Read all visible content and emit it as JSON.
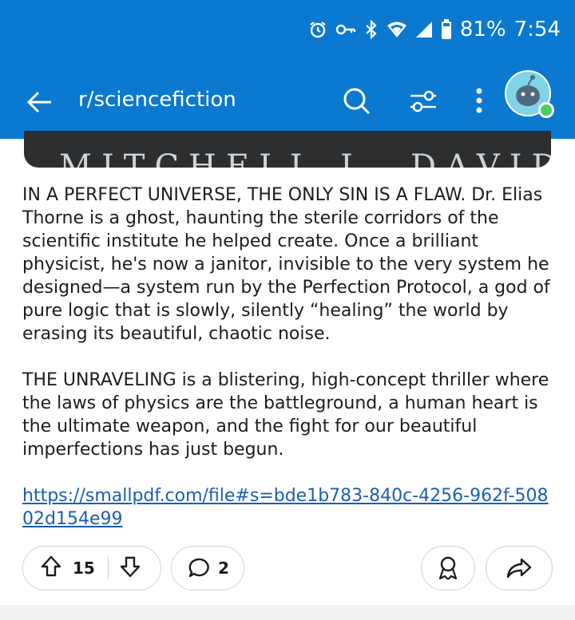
{
  "status_bar": {
    "battery": "81%",
    "time": "7:54"
  },
  "app_bar": {
    "subreddit": "r/sciencefiction",
    "icons": [
      "back-arrow-icon",
      "search-icon",
      "filter-icon",
      "more-vert-icon",
      "avatar"
    ]
  },
  "post": {
    "image_caption_partial": "MITCHELL L. DAVIDSON",
    "paragraph1": "IN A PERFECT UNIVERSE, THE ONLY SIN IS A FLAW. Dr. Elias Thorne is a ghost, haunting the sterile corridors of the scientific institute he helped create. Once a brilliant physicist, he's now a janitor, invisible to the very system he designed—a system run by the Perfection Protocol, a god of pure logic that is slowly, silently “healing” the world by erasing its beautiful, chaotic noise.",
    "paragraph2": "THE UNRAVELING is a blistering, high-concept thriller where the laws of physics are the battleground, a human heart is the ultimate weapon, and the fight for our beautiful imperfections has just begun.",
    "link": "https://smallpdf.com/file#s=bde1b783-840c-4256-962f-50802d154e99"
  },
  "actions": {
    "upvotes": "15",
    "comments": "2"
  },
  "colors": {
    "brand_blue": "#0b79d0",
    "link": "#1a5fb4",
    "online_dot": "#46d160"
  }
}
